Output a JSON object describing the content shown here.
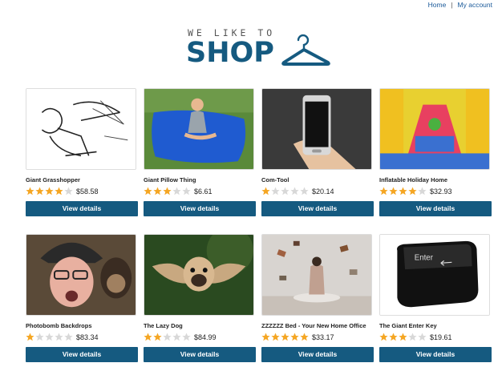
{
  "nav": {
    "home": "Home",
    "separator": "|",
    "account": "My account"
  },
  "logo": {
    "tagline": "WE LIKE TO",
    "word": "SHOP"
  },
  "colors": {
    "brand": "#155a80",
    "star_on": "#f5a623",
    "star_off": "#d8d8d8"
  },
  "products": [
    {
      "name": "Giant Grasshopper",
      "rating": 4,
      "price": "$58.58",
      "button": "View details",
      "icon": "sketch-man-image"
    },
    {
      "name": "Giant Pillow Thing",
      "rating": 3,
      "price": "$6.61",
      "button": "View details",
      "icon": "pillow-image"
    },
    {
      "name": "Com-Tool",
      "rating": 1,
      "price": "$20.14",
      "button": "View details",
      "icon": "phone-image"
    },
    {
      "name": "Inflatable Holiday Home",
      "rating": 4,
      "price": "$32.93",
      "button": "View details",
      "icon": "bouncy-castle-image"
    },
    {
      "name": "Photobomb Backdrops",
      "rating": 1,
      "price": "$83.34",
      "button": "View details",
      "icon": "monkey-man-image"
    },
    {
      "name": "The Lazy Dog",
      "rating": 2,
      "price": "$84.99",
      "button": "View details",
      "icon": "pug-image"
    },
    {
      "name": "ZZZZZZ Bed - Your New Home Office",
      "rating": 5,
      "price": "$33.17",
      "button": "View details",
      "icon": "flying-books-image"
    },
    {
      "name": "The Giant Enter Key",
      "rating": 3,
      "price": "$19.61",
      "button": "View details",
      "icon": "enter-key-image"
    }
  ]
}
